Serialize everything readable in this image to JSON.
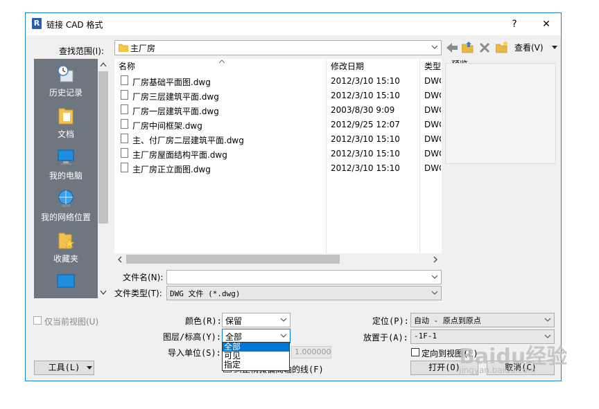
{
  "window": {
    "title": "链接 CAD 格式",
    "help": "?",
    "close": "✕",
    "app_icon_letter": "R"
  },
  "lookin": {
    "label": "查找范围(I):",
    "value": "主厂房"
  },
  "toolbar": {
    "view_label": "查看(V)"
  },
  "places": [
    {
      "label": "历史记录",
      "icon": "history-icon"
    },
    {
      "label": "文档",
      "icon": "documents-icon"
    },
    {
      "label": "我的电脑",
      "icon": "computer-icon"
    },
    {
      "label": "我的网络位置",
      "icon": "network-icon"
    },
    {
      "label": "收藏夹",
      "icon": "favorites-icon"
    },
    {
      "label": "",
      "icon": "desktop-icon"
    }
  ],
  "columns": {
    "name": "名称",
    "date": "修改日期",
    "type": "类型"
  },
  "files": [
    {
      "name": "厂房基础平面图.dwg",
      "date": "2012/3/10 15:10",
      "type": "DWG"
    },
    {
      "name": "厂房三层建筑平面.dwg",
      "date": "2012/3/10 15:10",
      "type": "DWG"
    },
    {
      "name": "厂房一层建筑平面.dwg",
      "date": "2003/8/30 9:09",
      "type": "DWG"
    },
    {
      "name": "厂房中间框架.dwg",
      "date": "2012/9/25 12:07",
      "type": "DWG"
    },
    {
      "name": "主、付厂房二层建筑平面.dwg",
      "date": "2012/3/10 15:10",
      "type": "DWG"
    },
    {
      "name": "主厂房屋面结构平面.dwg",
      "date": "2012/3/10 15:10",
      "type": "DWG"
    },
    {
      "name": "主厂房正立面图.dwg",
      "date": "2012/3/10 15:10",
      "type": "DWG"
    }
  ],
  "preview_label": "预览",
  "filename": {
    "label": "文件名(N):",
    "value": ""
  },
  "filetype": {
    "label": "文件类型(T):",
    "value": "DWG 文件 (*.dwg)"
  },
  "options": {
    "current_view_only": "仅当前视图(U)",
    "colors_label": "颜色(R):",
    "colors_value": "保留",
    "layers_label": "图层/标高(Y):",
    "layers_value": "全部",
    "layers_options": [
      "全部",
      "可见",
      "指定"
    ],
    "units_label": "导入单位(S):",
    "units_value": "1.000000",
    "correct_lines_label": "纠正稍微偏离轴的线(F)",
    "positioning_label": "定位(P):",
    "positioning_value": "自动 - 原点到原点",
    "place_at_label": "放置于(A):",
    "place_at_value": "-1F-1",
    "orient_label": "定向到视图(E)"
  },
  "buttons": {
    "tools": "工具(L)",
    "open": "打开(O)",
    "cancel": "取消(C)"
  },
  "watermark": {
    "main": "Baidu经验",
    "sub": "jingyan.baidu.com"
  }
}
